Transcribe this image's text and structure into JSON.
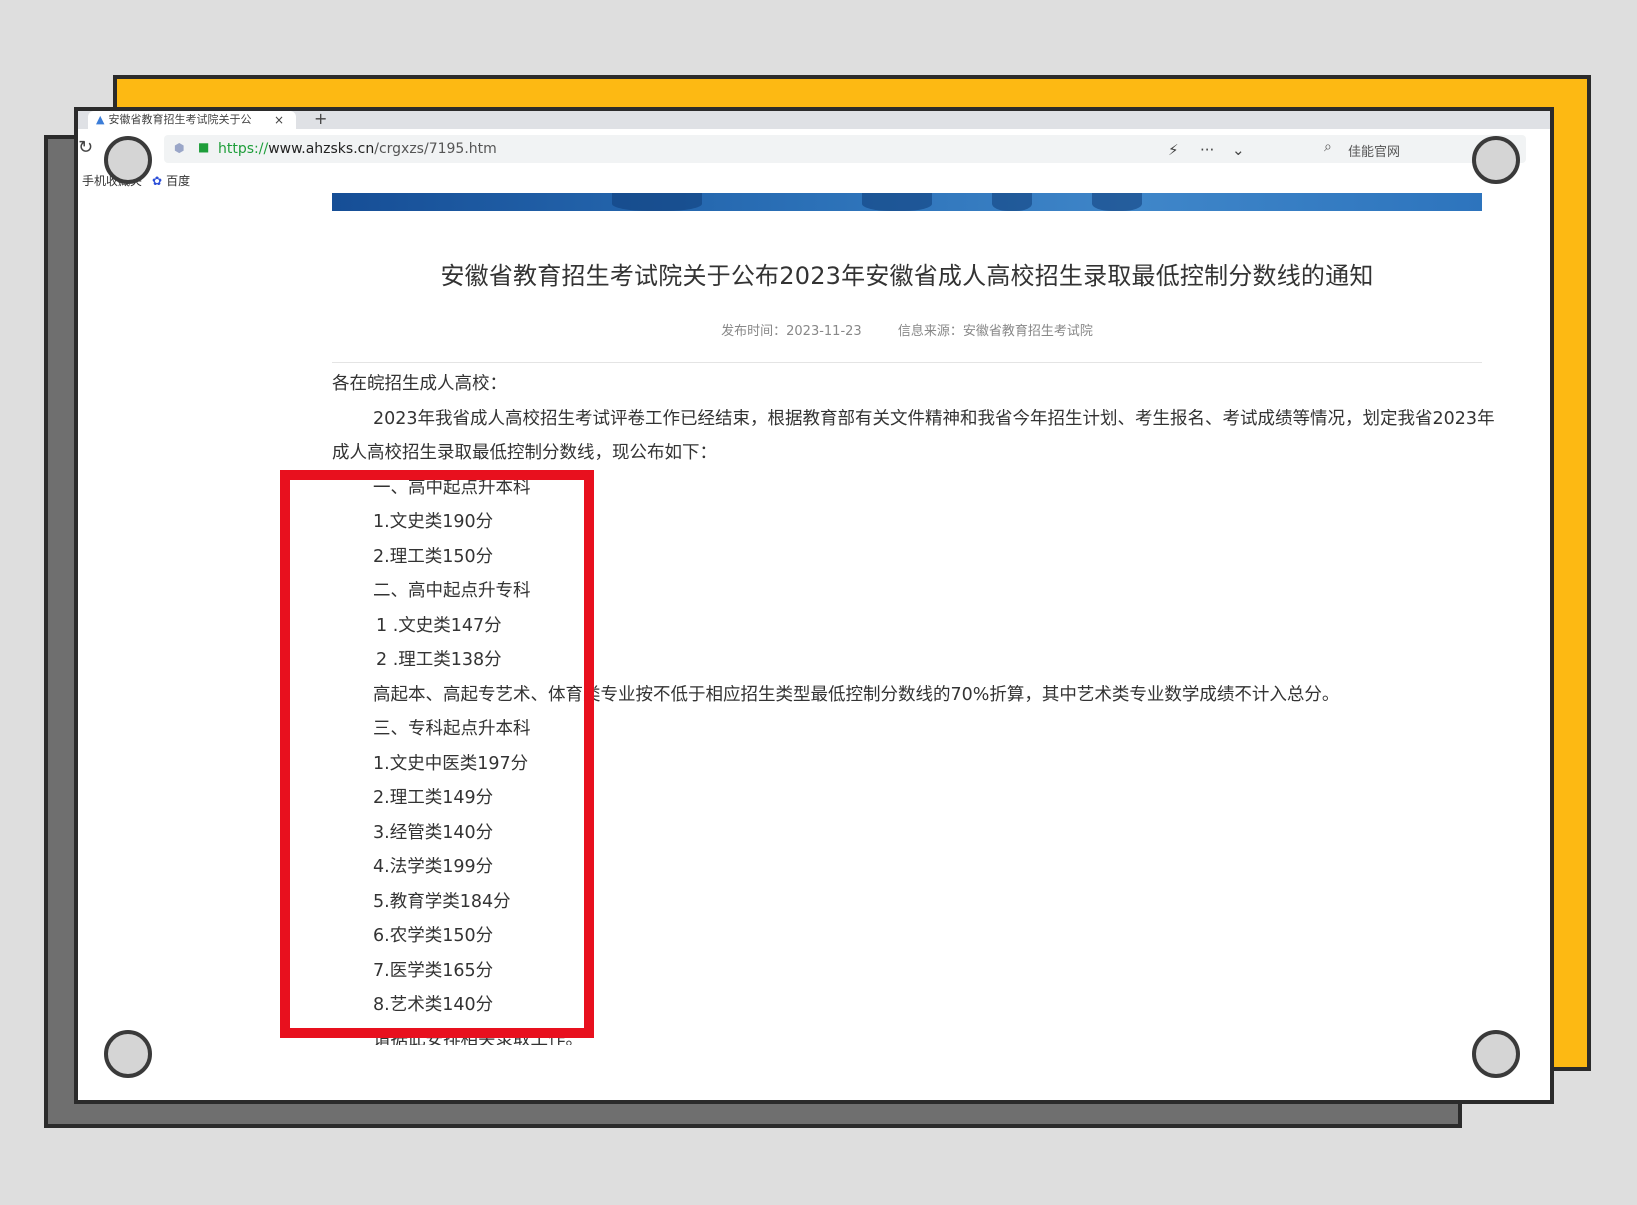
{
  "colors": {
    "background": "#dedede",
    "frame_yellow": "#fdb913",
    "frame_gray": "#6f6f6f",
    "highlight_red": "#e8101e",
    "secure_green": "#1e9e3a"
  },
  "browser": {
    "tab_title": "安徽省教育招生考试院关于公",
    "tab_close": "×",
    "tab_new": "+",
    "url_protocol": "https://",
    "url_host": "www.ahzsks.cn",
    "url_path": "/crgxzs/7195.htm",
    "search_text": "佳能官网",
    "bookmarks": [
      "手机收藏夹",
      "百度"
    ],
    "icons": [
      "reload-icon",
      "shield-icon",
      "lock-icon",
      "lightning-icon",
      "more-icon",
      "chevron-down-icon",
      "search-icon",
      "paw-icon"
    ]
  },
  "article": {
    "title": "安徽省教育招生考试院关于公布2023年安徽省成人高校招生录取最低控制分数线的通知",
    "publish_time": "发布时间：2023-11-23",
    "source": "信息来源：安徽省教育招生考试院",
    "salutation": "各在皖招生成人高校：",
    "intro_line1": "2023年我省成人高校招生考试评卷工作已经结束，根据教育部有关文件精神和我省今年招生计划、考生报名、考试成绩等情况，划定我省2023年",
    "intro_line2": "成人高校招生录取最低控制分数线，现公布如下：",
    "section1": {
      "heading": "一、高中起点升本科",
      "items": [
        "1.文史类190分",
        "2.理工类150分"
      ]
    },
    "section2": {
      "heading": "二、高中起点升专科",
      "items": [
        "1 .文史类147分",
        "2 .理工类138分"
      ]
    },
    "note": "高起本、高起专艺术、体育类专业按不低于相应招生类型最低控制分数线的70%折算，其中艺术类专业数学成绩不计入总分。",
    "section3": {
      "heading": "三、专科起点升本科",
      "items": [
        "1.文史中医类197分",
        "2.理工类149分",
        "3.经管类140分",
        "4.法学类199分",
        "5.教育学类184分",
        "6.农学类150分",
        "7.医学类165分",
        "8.艺术类140分"
      ]
    },
    "closing": "请据此安排相关录取工作。"
  }
}
